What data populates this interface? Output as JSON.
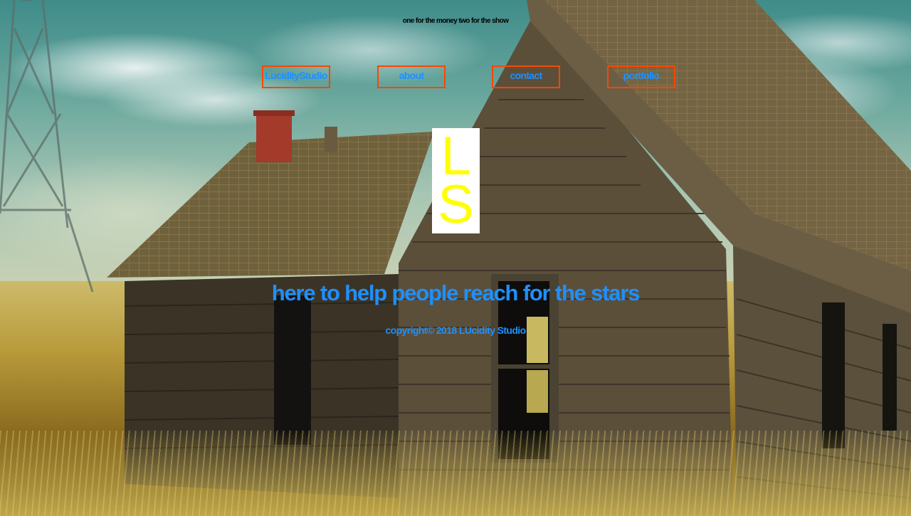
{
  "site": {
    "tagline": "one for the money two for the show",
    "logo": {
      "letter_top": "L",
      "letter_bottom": "S",
      "letter_color": "#ffff00",
      "background_color": "#ffffff"
    },
    "nav": {
      "items": [
        {
          "label": "LucidityStudio"
        },
        {
          "label": "about"
        },
        {
          "label": "contact"
        },
        {
          "label": "portfolio"
        }
      ],
      "text_color": "#1e90ff",
      "border_color": "#ff4500"
    },
    "headline": "here to help people reach for the stars",
    "copyright": "copyright© 2018 LUcidity Studio"
  }
}
